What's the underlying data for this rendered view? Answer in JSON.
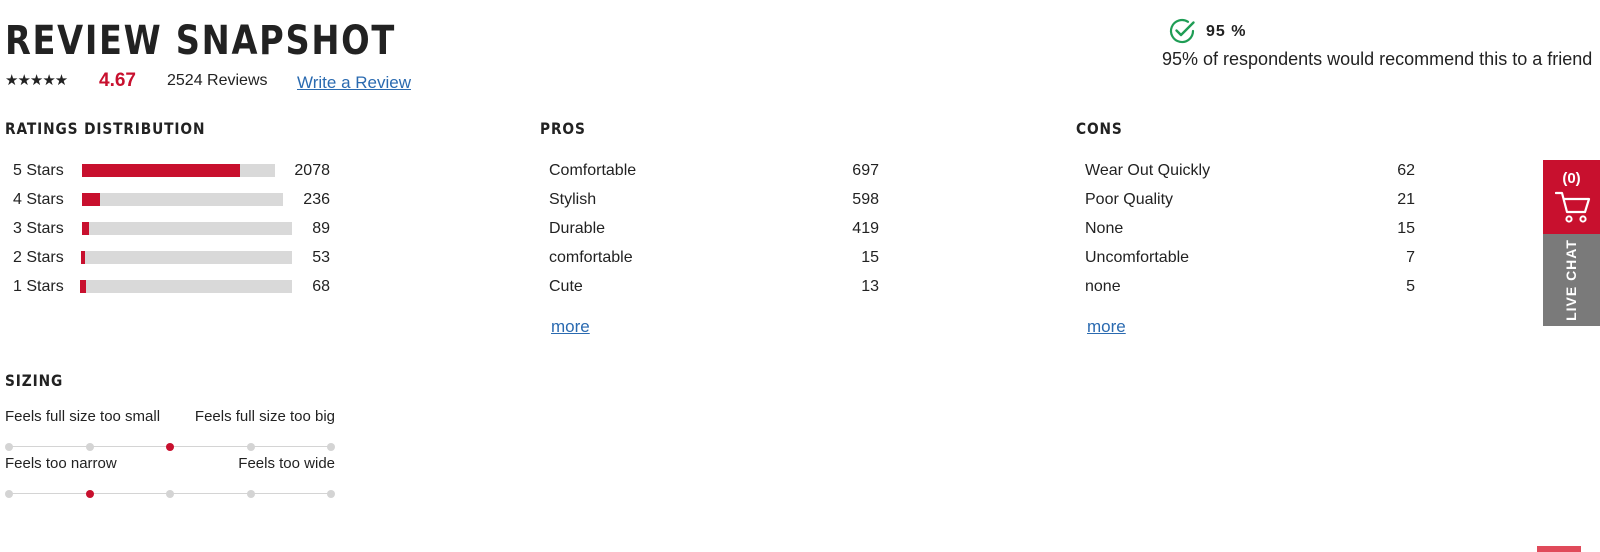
{
  "header": {
    "title": "REVIEW SNAPSHOT",
    "stars": "★★★★★",
    "average": "4.67",
    "review_count": "2524 Reviews",
    "write_review": "Write a Review"
  },
  "recommend": {
    "percent": "95 %",
    "text": "95% of respondents would recommend this to a friend"
  },
  "distribution": {
    "title": "RATINGS DISTRIBUTION",
    "rows": [
      {
        "label": "5 Stars",
        "count": "2078",
        "fraction": 0.82
      },
      {
        "label": "4 Stars",
        "count": "236",
        "fraction": 0.09
      },
      {
        "label": "3 Stars",
        "count": "89",
        "fraction": 0.035
      },
      {
        "label": "2 Stars",
        "count": "53",
        "fraction": 0.021
      },
      {
        "label": "1 Stars",
        "count": "68",
        "fraction": 0.027
      }
    ]
  },
  "pros": {
    "title": "PROS",
    "items": [
      {
        "label": "Comfortable",
        "count": "697"
      },
      {
        "label": "Stylish",
        "count": "598"
      },
      {
        "label": "Durable",
        "count": "419"
      },
      {
        "label": "comfortable",
        "count": "15"
      },
      {
        "label": "Cute",
        "count": "13"
      }
    ],
    "more": "more"
  },
  "cons": {
    "title": "CONS",
    "items": [
      {
        "label": "Wear Out Quickly",
        "count": "62"
      },
      {
        "label": "Poor Quality",
        "count": "21"
      },
      {
        "label": "None",
        "count": "15"
      },
      {
        "label": "Uncomfortable",
        "count": "7"
      },
      {
        "label": "none",
        "count": "5"
      }
    ],
    "more": "more"
  },
  "sizing": {
    "title": "SIZING",
    "scales": [
      {
        "left": "Feels full size too small",
        "right": "Feels full size too big",
        "points": 5,
        "selected": 2
      },
      {
        "left": "Feels too narrow",
        "right": "Feels too wide",
        "points": 5,
        "selected": 1
      }
    ]
  },
  "side_widgets": {
    "cart_count": "(0)",
    "live_chat": "LIVE CHAT"
  },
  "colors": {
    "accent": "#c8102e",
    "link": "#2a6ab0",
    "track": "#d9d9d9",
    "check": "#1f9d55"
  }
}
